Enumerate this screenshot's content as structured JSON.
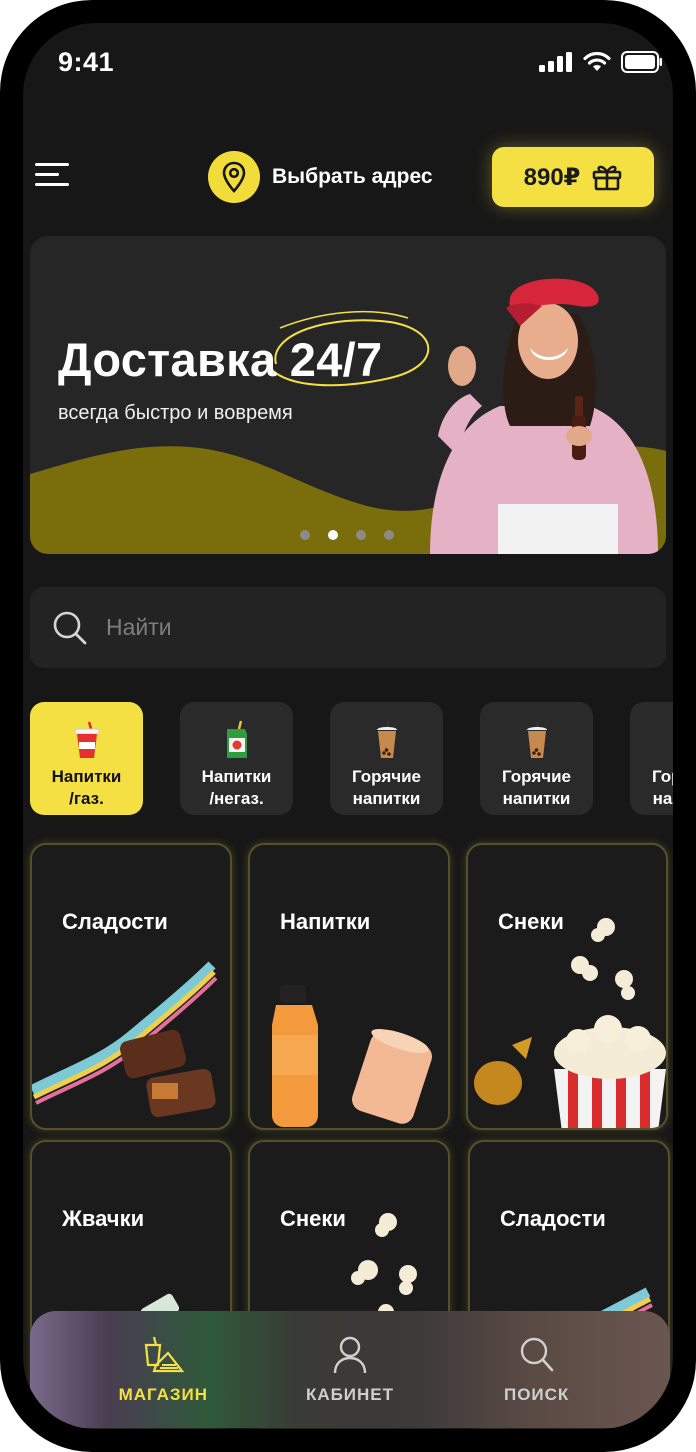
{
  "status_bar": {
    "time": "9:41"
  },
  "header": {
    "address_label": "Выбрать адрес",
    "bonus_amount": "890₽"
  },
  "banner": {
    "title": "Доставка 24/7",
    "subtitle": "всегда быстро и вовремя",
    "page_count": 4,
    "active_page": 2
  },
  "search": {
    "placeholder": "Найти"
  },
  "categories": [
    {
      "label": "Напитки\n/газ.",
      "icon": "soda-cup-icon",
      "active": true
    },
    {
      "label": "Напитки\n/негаз.",
      "icon": "juice-box-icon",
      "active": false
    },
    {
      "label": "Горячие\nнапитки",
      "icon": "bubble-tea-icon",
      "active": false
    },
    {
      "label": "Горячие\nнапитки",
      "icon": "bubble-tea-icon",
      "active": false
    },
    {
      "label": "Горячие\nнапитки",
      "icon": "bubble-tea-icon",
      "active": false
    }
  ],
  "products": [
    {
      "title": "Сладости"
    },
    {
      "title": "Напитки"
    },
    {
      "title": "Снеки"
    },
    {
      "title": "Жвачки"
    },
    {
      "title": "Снеки"
    },
    {
      "title": "Сладости"
    }
  ],
  "tabbar": {
    "shop": "МАГАЗИН",
    "account": "КАБИНЕТ",
    "search": "ПОИСК"
  },
  "colors": {
    "accent": "#f4e043",
    "background": "#171717",
    "banner_wave": "#7a6d0c"
  }
}
